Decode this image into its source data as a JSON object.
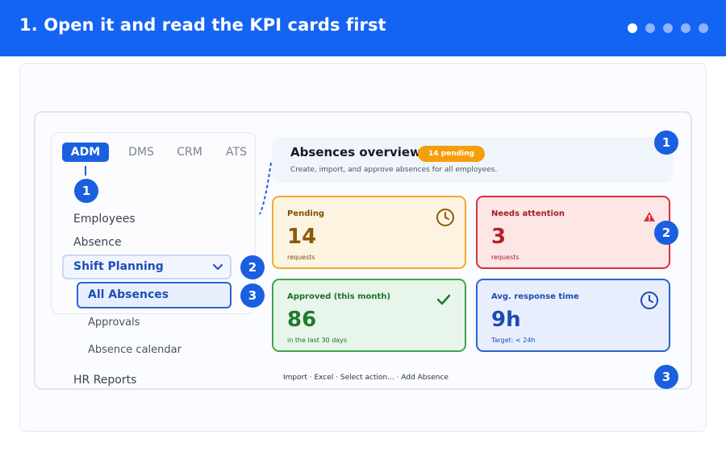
{
  "header": {
    "title": "1. Open it and read the KPI cards first",
    "step_dots": [
      {
        "icon": "step-dot",
        "active": true
      },
      {
        "icon": "step-dot",
        "active": false
      },
      {
        "icon": "step-dot",
        "active": false
      },
      {
        "icon": "step-dot",
        "active": false
      },
      {
        "icon": "step-dot",
        "active": false
      }
    ]
  },
  "app_tabs": [
    {
      "label": "ADM",
      "active": true
    },
    {
      "label": "DMS",
      "active": false
    },
    {
      "label": "CRM",
      "active": false
    },
    {
      "label": "ATS",
      "active": false
    }
  ],
  "sidebar": {
    "items": [
      {
        "label": "Employees"
      },
      {
        "label": "Absence"
      },
      {
        "label": "Shift Planning",
        "expanded": true
      },
      {
        "label": "All Absences",
        "selected": true
      },
      {
        "label": "Approvals"
      },
      {
        "label": "Absence calendar"
      },
      {
        "label": "HR Reports"
      }
    ]
  },
  "badges": {
    "tab": "1",
    "shift_planning": "2",
    "all_absences": "3",
    "overview": "1",
    "kpi_right": "2",
    "toolbar": "3"
  },
  "overview": {
    "title": "Absences overview",
    "pill": "14 pending",
    "subtitle": "Create, import, and approve absences for all employees."
  },
  "kpis": {
    "pending": {
      "label": "Pending",
      "value": "14",
      "note": "requests",
      "icon": "clock-icon"
    },
    "attention": {
      "label": "Needs attention",
      "value": "3",
      "note": "requests",
      "icon": "warning-icon"
    },
    "approved": {
      "label": "Approved (this month)",
      "value": "86",
      "note": "in the last 30 days",
      "icon": "checkmark-icon"
    },
    "response": {
      "label": "Avg. response time",
      "value": "9h",
      "note": "Target: < 24h",
      "icon": "clock-icon"
    }
  },
  "toolbar": {
    "text": "Import · Excel · Select action... · Add Absence"
  },
  "colors": {
    "brand": "#1464f4",
    "pending": "#f59e0b",
    "attention": "#d9313b",
    "approved": "#3ea44b",
    "response": "#2a63d6"
  }
}
